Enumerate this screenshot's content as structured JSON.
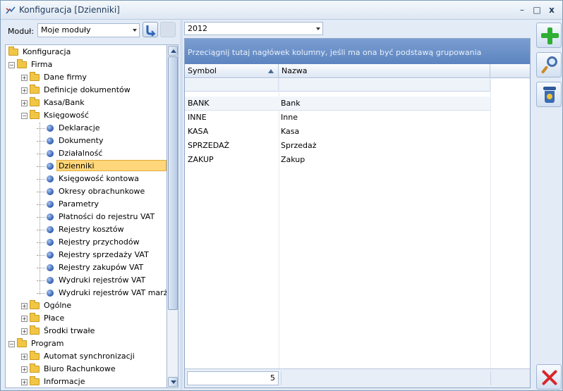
{
  "window": {
    "title": "Konfiguracja [Dzienniki]",
    "buttons": [
      "–",
      "□",
      "x"
    ]
  },
  "module": {
    "label": "Moduł:",
    "value": "Moje moduły"
  },
  "tree": {
    "items": [
      {
        "label": "Konfiguracja",
        "level": 0,
        "type": "folder",
        "expander": ""
      },
      {
        "label": "Firma",
        "level": 1,
        "type": "folder",
        "expander": "−"
      },
      {
        "label": "Dane firmy",
        "level": 2,
        "type": "folder",
        "expander": "+"
      },
      {
        "label": "Definicje dokumentów",
        "level": 2,
        "type": "folder",
        "expander": "+"
      },
      {
        "label": "Kasa/Bank",
        "level": 2,
        "type": "folder",
        "expander": "+"
      },
      {
        "label": "Księgowość",
        "level": 2,
        "type": "folder",
        "expander": "−"
      },
      {
        "label": "Deklaracje",
        "level": 3,
        "type": "leaf"
      },
      {
        "label": "Dokumenty",
        "level": 3,
        "type": "leaf"
      },
      {
        "label": "Działalność",
        "level": 3,
        "type": "leaf"
      },
      {
        "label": "Dzienniki",
        "level": 3,
        "type": "leaf",
        "selected": true
      },
      {
        "label": "Księgowość kontowa",
        "level": 3,
        "type": "leaf"
      },
      {
        "label": "Okresy obrachunkowe",
        "level": 3,
        "type": "leaf"
      },
      {
        "label": "Parametry",
        "level": 3,
        "type": "leaf"
      },
      {
        "label": "Płatności do rejestru VAT",
        "level": 3,
        "type": "leaf"
      },
      {
        "label": "Rejestry kosztów",
        "level": 3,
        "type": "leaf"
      },
      {
        "label": "Rejestry przychodów",
        "level": 3,
        "type": "leaf"
      },
      {
        "label": "Rejestry sprzedaży VAT",
        "level": 3,
        "type": "leaf"
      },
      {
        "label": "Rejestry zakupów VAT",
        "level": 3,
        "type": "leaf"
      },
      {
        "label": "Wydruki rejestrów VAT",
        "level": 3,
        "type": "leaf"
      },
      {
        "label": "Wydruki rejestrów VAT marża",
        "level": 3,
        "type": "leaf"
      },
      {
        "label": "Ogólne",
        "level": 2,
        "type": "folder",
        "expander": "+"
      },
      {
        "label": "Płace",
        "level": 2,
        "type": "folder",
        "expander": "+"
      },
      {
        "label": "Środki trwałe",
        "level": 2,
        "type": "folder",
        "expander": "+"
      },
      {
        "label": "Program",
        "level": 1,
        "type": "folder",
        "expander": "−"
      },
      {
        "label": "Automat synchronizacji",
        "level": 2,
        "type": "folder",
        "expander": "+"
      },
      {
        "label": "Biuro Rachunkowe",
        "level": 2,
        "type": "folder",
        "expander": "+"
      },
      {
        "label": "Informacje",
        "level": 2,
        "type": "folder",
        "expander": "+"
      }
    ]
  },
  "year": {
    "value": "2012"
  },
  "grid": {
    "group_hint": "Przeciągnij tutaj nagłówek kolumny, jeśli ma ona być podstawą grupowania",
    "columns": [
      "Symbol",
      "Nazwa"
    ],
    "rows": [
      {
        "symbol": "BANK",
        "nazwa": "Bank"
      },
      {
        "symbol": "INNE",
        "nazwa": "Inne"
      },
      {
        "symbol": "KASA",
        "nazwa": "Kasa"
      },
      {
        "symbol": "SPRZEDAŻ",
        "nazwa": "Sprzedaż"
      },
      {
        "symbol": "ZAKUP",
        "nazwa": "Zakup"
      }
    ],
    "count": "5"
  },
  "icons": {
    "add": "plus-icon",
    "preview": "magnifier-icon",
    "delete": "trash-icon",
    "close": "close-x-icon"
  },
  "colors": {
    "group_area": "#6a90c8",
    "selection": "#ffd77a",
    "add_green": "#2fae34",
    "close_red": "#d8262b"
  }
}
